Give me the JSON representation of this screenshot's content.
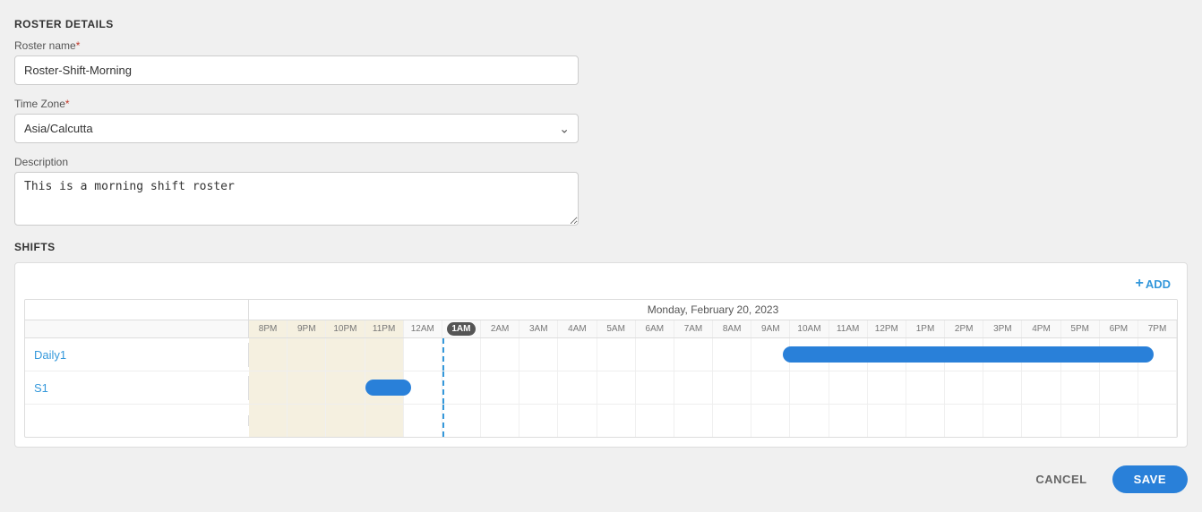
{
  "page": {
    "roster_details_title": "ROSTER DETAILS",
    "shifts_title": "SHIFTS"
  },
  "form": {
    "roster_name_label": "Roster name",
    "roster_name_required": "*",
    "roster_name_value": "Roster-Shift-Morning",
    "timezone_label": "Time Zone",
    "timezone_required": "*",
    "timezone_value": "Asia/Calcutta",
    "description_label": "Description",
    "description_value": "This is a morning shift roster"
  },
  "timeline": {
    "date_header": "Monday, February 20, 2023",
    "add_label": "ADD",
    "hours": [
      "8PM",
      "9PM",
      "10PM",
      "11PM",
      "12AM",
      "1AM",
      "2AM",
      "3AM",
      "4AM",
      "5AM",
      "6AM",
      "7AM",
      "8AM",
      "9AM",
      "10AM",
      "11AM",
      "12PM",
      "1PM",
      "2PM",
      "3PM",
      "4PM",
      "5PM",
      "6PM",
      "7PM"
    ],
    "current_hour": "1AM",
    "rows": [
      {
        "name": "Daily1",
        "bar_start_percent": 57.5,
        "bar_width_percent": 40
      },
      {
        "name": "S1",
        "bar_start_percent": 12.5,
        "bar_width_percent": 5
      },
      {
        "name": "",
        "bar_start_percent": null,
        "bar_width_percent": null
      }
    ]
  },
  "footer": {
    "cancel_label": "CANCEL",
    "save_label": "SAVE"
  }
}
